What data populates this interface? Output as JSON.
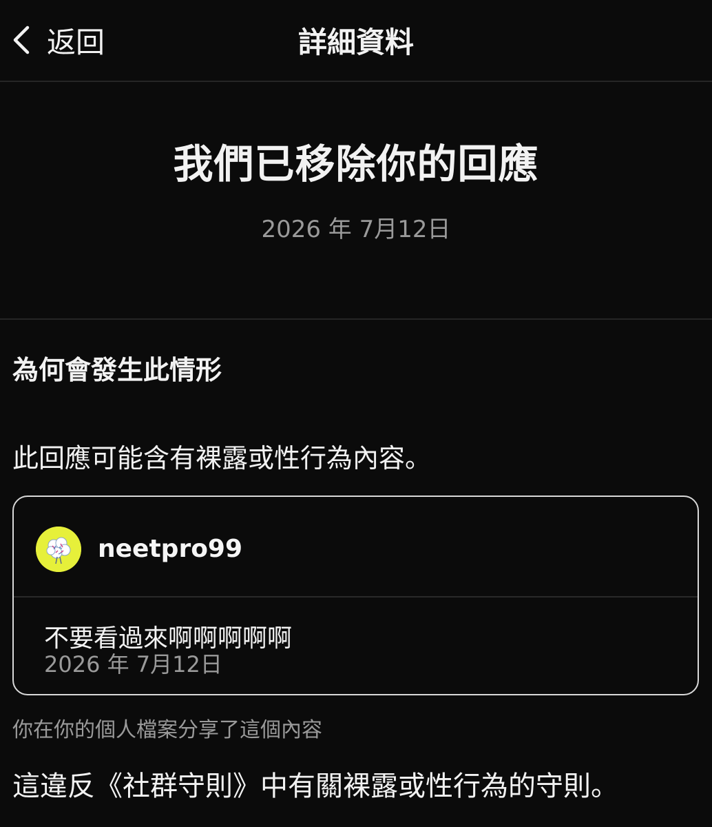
{
  "header": {
    "back_label": "返回",
    "title": "詳細資料"
  },
  "hero": {
    "title": "我們已移除你的回應",
    "date": "2026 年 7月12日"
  },
  "section": {
    "heading": "為何會發生此情形",
    "reason": "此回應可能含有裸露或性行為內容。"
  },
  "card": {
    "username": "neetpro99",
    "reply_text": "不要看過來啊啊啊啊啊",
    "reply_date": "2026 年 7月12日"
  },
  "shared_note": "你在你的個人檔案分享了這個內容",
  "violation": "這違反《社群守則》中有關裸露或性行為的守則。",
  "icons": {
    "back": "chevron-left-icon",
    "avatar": "avatar-image"
  },
  "colors": {
    "background": "#0b0b0b",
    "avatar_bg": "#e6f03a",
    "muted_text": "#9a9a9a"
  }
}
